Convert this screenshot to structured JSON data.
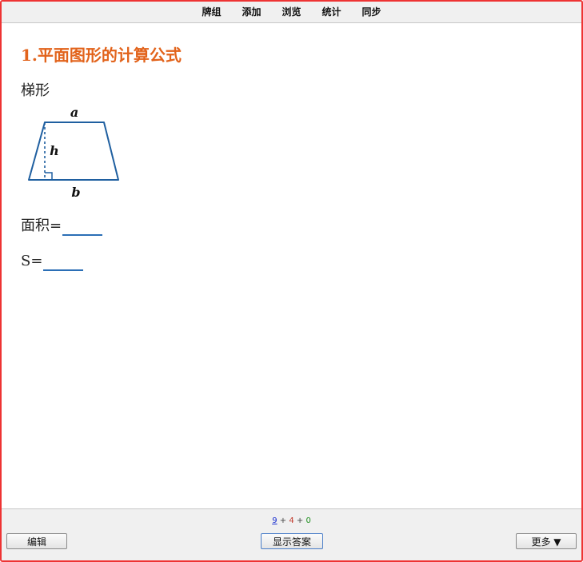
{
  "topbar": {
    "items": [
      "牌组",
      "添加",
      "浏览",
      "统计",
      "同步"
    ]
  },
  "card": {
    "title": "1.平面图形的计算公式",
    "shape_label": "梯形",
    "figure": {
      "top_label": "a",
      "height_label": "h",
      "bottom_label": "b",
      "line_color": "#1f5fa0"
    },
    "area_label": "面积=",
    "s_label": "S="
  },
  "bottombar": {
    "counts": {
      "new": "9",
      "sep1": " + ",
      "learn": "4",
      "sep2": " + ",
      "review": "0"
    },
    "edit_label": "编辑",
    "show_answer_label": "显示答案",
    "more_label": "更多 ▼"
  },
  "colors": {
    "title": "#e2631b",
    "frame_border": "#ee3333",
    "blank_underline": "#2b6fb6"
  }
}
